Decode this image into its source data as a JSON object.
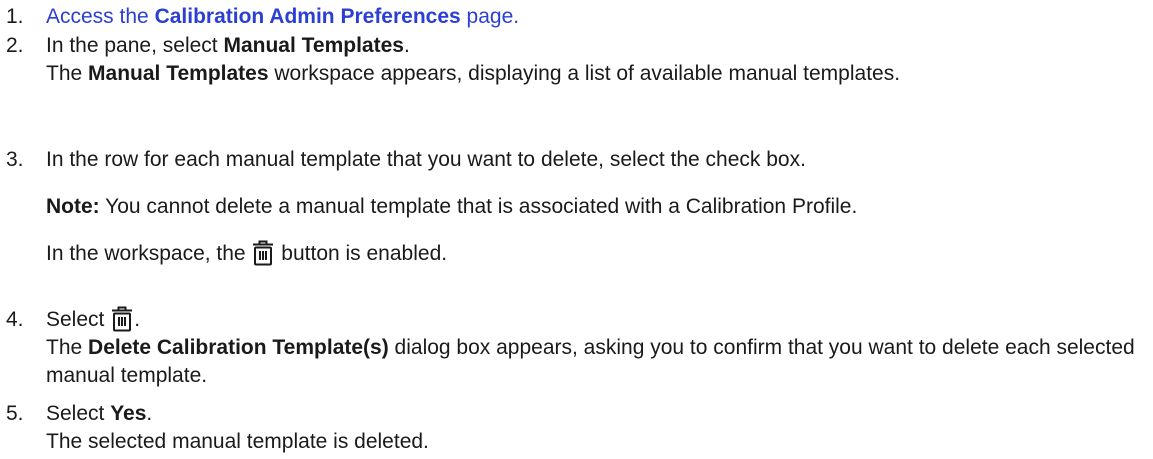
{
  "steps": [
    {
      "number": "1.",
      "before": "Access the ",
      "link_bold": "Calibration Admin Preferences",
      "after": " page."
    },
    {
      "number": "2.",
      "line1_before": "In the pane, select ",
      "line1_bold": "Manual Templates",
      "line1_after": ".",
      "line2_before": "The ",
      "line2_bold": "Manual Templates",
      "line2_after": " workspace appears, displaying a list of available manual templates."
    },
    {
      "number": "3.",
      "line1": "In the row for each manual template that you want to delete, select the check box.",
      "note_label": "Note:",
      "note_text": " You cannot delete a manual template that is associated with a Calibration Profile.",
      "enabled_before": "In the workspace, the ",
      "enabled_after": " button is enabled."
    },
    {
      "number": "4.",
      "line1_before": "Select ",
      "line1_after": ".",
      "line2_before": "The ",
      "line2_bold": "Delete Calibration Template(s)",
      "line2_after": " dialog box appears, asking you to confirm that you want to delete each selected manual template."
    },
    {
      "number": "5.",
      "line1_before": "Select ",
      "line1_bold": "Yes",
      "line1_after": ".",
      "line2": "The selected manual template is deleted."
    }
  ],
  "icons": {
    "delete": "trash-icon"
  },
  "colors": {
    "link": "#2b3fd3",
    "text": "#1a1a1a"
  }
}
